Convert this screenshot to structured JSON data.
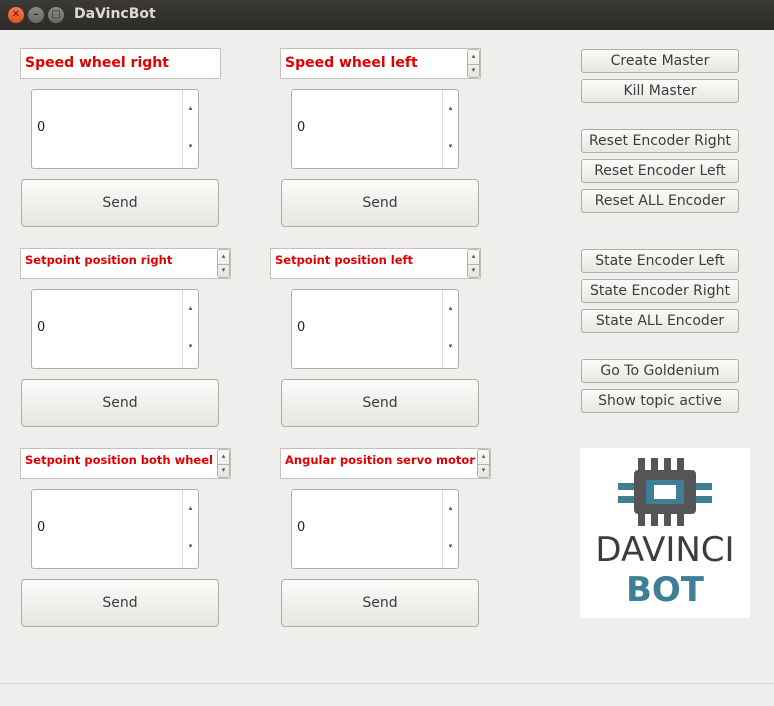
{
  "window": {
    "title": "DaVincBot",
    "controls": [
      "close-icon",
      "minimize-icon",
      "maximize-icon"
    ]
  },
  "panels": [
    {
      "label": "Speed wheel right",
      "value": "0",
      "send": "Send"
    },
    {
      "label": "Speed wheel left",
      "value": "0",
      "send": "Send"
    },
    {
      "label": "Setpoint position right",
      "value": "0",
      "send": "Send"
    },
    {
      "label": "Setpoint position left",
      "value": "0",
      "send": "Send"
    },
    {
      "label": "Setpoint position both wheel",
      "value": "0",
      "send": "Send"
    },
    {
      "label": "Angular position servo motor",
      "value": "0",
      "send": "Send"
    }
  ],
  "right_buttons": {
    "create_master": "Create Master",
    "kill_master": "Kill Master",
    "reset_encoder_right": "Reset Encoder Right",
    "reset_encoder_left": "Reset Encoder Left",
    "reset_all_encoder": "Reset ALL Encoder",
    "state_encoder_left": "State Encoder Left",
    "state_encoder_right": "State Encoder Right",
    "state_all_encoder": "State ALL Encoder",
    "go_to_goldenium": "Go To Goldenium",
    "show_topic_active": "Show topic active"
  },
  "logo": {
    "line1": "DAVINCI",
    "line2": "BOT",
    "colors": {
      "dark": "#555555",
      "accent": "#3e7f96"
    }
  },
  "colors": {
    "label_text": "#e00000",
    "title_bar": "#2c2b28",
    "background": "#efeeec"
  }
}
